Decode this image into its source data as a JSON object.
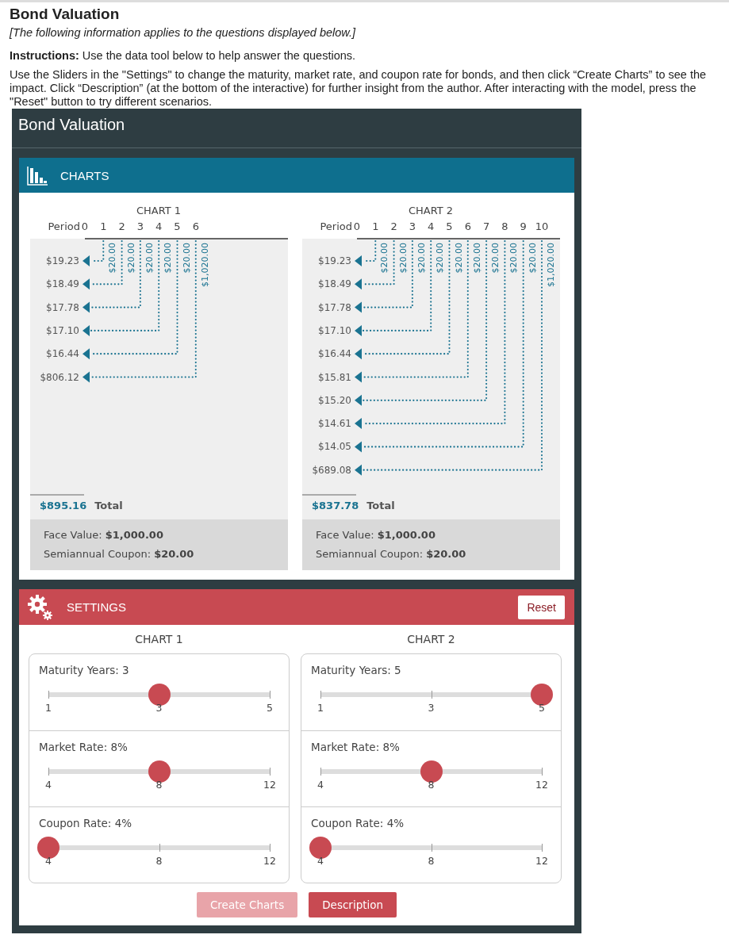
{
  "page": {
    "title": "Bond Valuation",
    "note": "[The following information applies to the questions displayed below.]",
    "instructions": "**Instructions:** Use the data tool below to help answer the questions.",
    "paragraph": "Use the Sliders in the \"Settings\" to change the maturity, market rate, and coupon rate for bonds, and then click “Create Charts” to see the impact. Click “Description” (at the bottom of the interactive) for further insight from the author. After interacting with the model, press the \"Reset\" button to try different scenarios."
  },
  "tool": {
    "title": "Bond Valuation",
    "charts_header": "CHARTS",
    "charts": [
      {
        "title": "CHART 1",
        "period_label": "Period",
        "periods": [
          "0",
          "1",
          "2",
          "3",
          "4",
          "5",
          "6"
        ],
        "cash_flows": [
          "$20.00",
          "$20.00",
          "$20.00",
          "$20.00",
          "$20.00",
          "$1,020.00"
        ],
        "present_values": [
          "$19.23",
          "$18.49",
          "$17.78",
          "$17.10",
          "$16.44",
          "$806.12"
        ],
        "total": "$895.16",
        "total_label": "Total",
        "face_value": "Face Value: **$1,000.00**",
        "coupon": "Semiannual Coupon: **$20.00**"
      },
      {
        "title": "CHART 2",
        "period_label": "Period",
        "periods": [
          "0",
          "1",
          "2",
          "3",
          "4",
          "5",
          "6",
          "7",
          "8",
          "9",
          "10"
        ],
        "cash_flows": [
          "$20.00",
          "$20.00",
          "$20.00",
          "$20.00",
          "$20.00",
          "$20.00",
          "$20.00",
          "$20.00",
          "$20.00",
          "$1,020.00"
        ],
        "present_values": [
          "$19.23",
          "$18.49",
          "$17.78",
          "$17.10",
          "$16.44",
          "$15.81",
          "$15.20",
          "$14.61",
          "$14.05",
          "$689.08"
        ],
        "total": "$837.78",
        "total_label": "Total",
        "face_value": "Face Value: **$1,000.00**",
        "coupon": "Semiannual Coupon: **$20.00**"
      }
    ],
    "settings_header": "SETTINGS",
    "reset": "Reset",
    "settings": [
      {
        "title": "CHART 1",
        "sliders": [
          {
            "label": "Maturity Years: 3",
            "level": 0.5,
            "ticks": [
              "1",
              "3",
              "5"
            ]
          },
          {
            "label": "Market Rate: 8%",
            "level": 0.5,
            "ticks": [
              "4",
              "8",
              "12"
            ]
          },
          {
            "label": "Coupon Rate: 4%",
            "level": 0,
            "ticks": [
              "4",
              "8",
              "12"
            ]
          }
        ]
      },
      {
        "title": "CHART 2",
        "sliders": [
          {
            "label": "Maturity Years: 5",
            "level": 1,
            "ticks": [
              "1",
              "3",
              "5"
            ]
          },
          {
            "label": "Market Rate: 8%",
            "level": 0.5,
            "ticks": [
              "4",
              "8",
              "12"
            ]
          },
          {
            "label": "Coupon Rate: 4%",
            "level": 0,
            "ticks": [
              "4",
              "8",
              "12"
            ]
          }
        ]
      }
    ],
    "buttons": [
      {
        "label": "Create Charts",
        "disabled": true
      },
      {
        "label": "Description",
        "disabled": false
      }
    ]
  }
}
